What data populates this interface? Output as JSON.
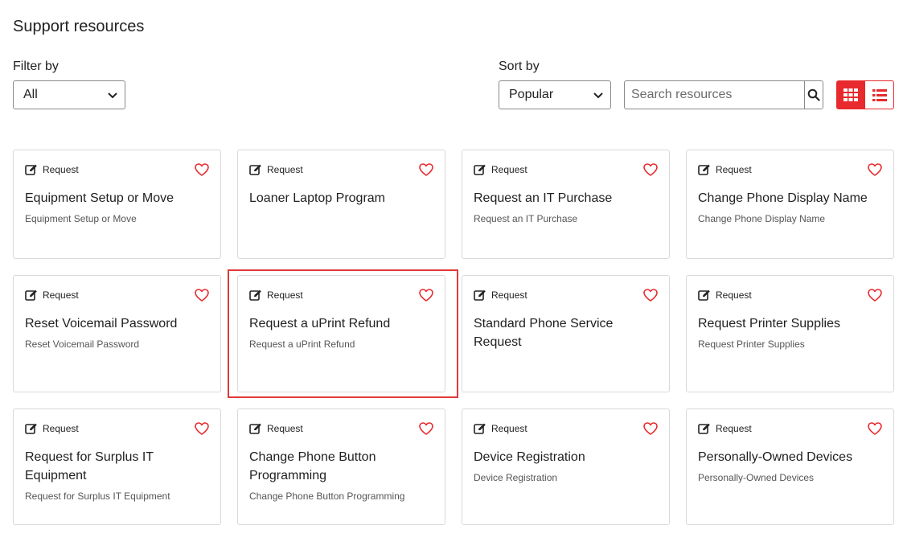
{
  "page": {
    "title": "Support resources"
  },
  "filter": {
    "label": "Filter by",
    "selected": "All"
  },
  "sort": {
    "label": "Sort by",
    "selected": "Popular"
  },
  "search": {
    "placeholder": "Search resources",
    "icon": "search-icon"
  },
  "view_toggle": {
    "active": "grid",
    "grid_icon": "grid-icon",
    "list_icon": "list-icon"
  },
  "colors": {
    "accent": "#e8292d",
    "border": "#d9d9d9",
    "highlight": "#e03a3a"
  },
  "cards": [
    {
      "tag": "Request",
      "title": "Equipment Setup or Move",
      "desc": "Equipment Setup or Move"
    },
    {
      "tag": "Request",
      "title": "Loaner Laptop Program",
      "desc": ""
    },
    {
      "tag": "Request",
      "title": "Request an IT Purchase",
      "desc": "Request an IT Purchase"
    },
    {
      "tag": "Request",
      "title": "Change Phone Display Name",
      "desc": "Change Phone Display Name"
    },
    {
      "tag": "Request",
      "title": "Reset Voicemail Password",
      "desc": "Reset Voicemail Password"
    },
    {
      "tag": "Request",
      "title": "Request a uPrint Refund",
      "desc": "Request a uPrint Refund",
      "highlighted": true
    },
    {
      "tag": "Request",
      "title": "Standard Phone Service Request",
      "desc": ""
    },
    {
      "tag": "Request",
      "title": "Request Printer Supplies",
      "desc": "Request Printer Supplies"
    },
    {
      "tag": "Request",
      "title": "Request for Surplus IT Equipment",
      "desc": "Request for Surplus IT Equipment"
    },
    {
      "tag": "Request",
      "title": "Change Phone Button Programming",
      "desc": "Change Phone Button Programming"
    },
    {
      "tag": "Request",
      "title": "Device Registration",
      "desc": "Device Registration"
    },
    {
      "tag": "Request",
      "title": "Personally-Owned Devices",
      "desc": "Personally-Owned Devices"
    }
  ]
}
